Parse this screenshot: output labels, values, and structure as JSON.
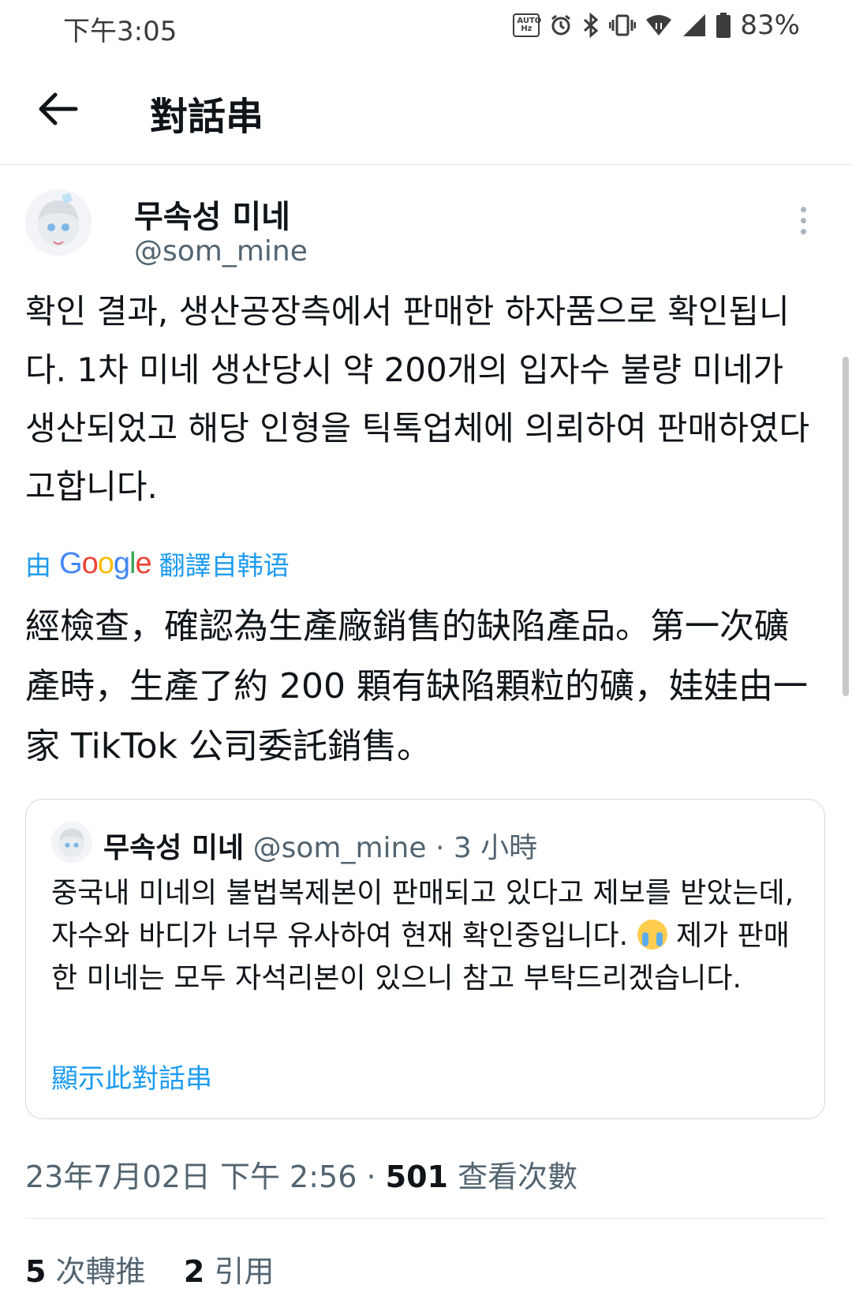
{
  "status_bar": {
    "time": "下午3:05",
    "autohz": "AUTO Hz",
    "battery": "83%"
  },
  "header": {
    "title": "對話串"
  },
  "tweet": {
    "display_name": "무속성 미네",
    "handle": "@som_mine",
    "text": "확인 결과, 생산공장측에서 판매한 하자품으로 확인됩니다. 1차 미네 생산당시 약 200개의 입자수 불량 미네가 생산되었고 해당 인형을 틱톡업체에 의뢰하여 판매하였다고합니다.",
    "translate_prefix": "由",
    "translate_brand": "Google",
    "translate_suffix": "翻譯自韩语",
    "translated_text": "經檢查，確認為生產廠銷售的缺陷產品。第一次礦產時，生產了約 200 顆有缺陷顆粒的礦，娃娃由一家 TikTok 公司委託銷售。",
    "timestamp": "23年7月02日 下午 2:56",
    "dot": "·",
    "views_count": "501",
    "views_label": "查看次數",
    "retweets_count": "5",
    "retweets_label": "次轉推",
    "quotes_count": "2",
    "quotes_label": "引用"
  },
  "quoted": {
    "display_name": "무속성 미네",
    "handle": "@som_mine",
    "time": "· 3 小時",
    "text_before_emoji": "중국내 미네의 불법복제본이 판매되고 있다고 제보를 받았는데, 자수와 바디가 너무 유사하여 현재 확인중입니다.",
    "emoji": "loudly-crying-face",
    "text_after_emoji": "제가 판매한 미네는 모두 자석리본이 있으니 참고 부탁드리겠습니다.",
    "show_thread": "顯示此對話串"
  },
  "colors": {
    "link": "#1d9bf0",
    "secondary": "#536471",
    "primary": "#0f1419",
    "border": "#cfd9de"
  }
}
